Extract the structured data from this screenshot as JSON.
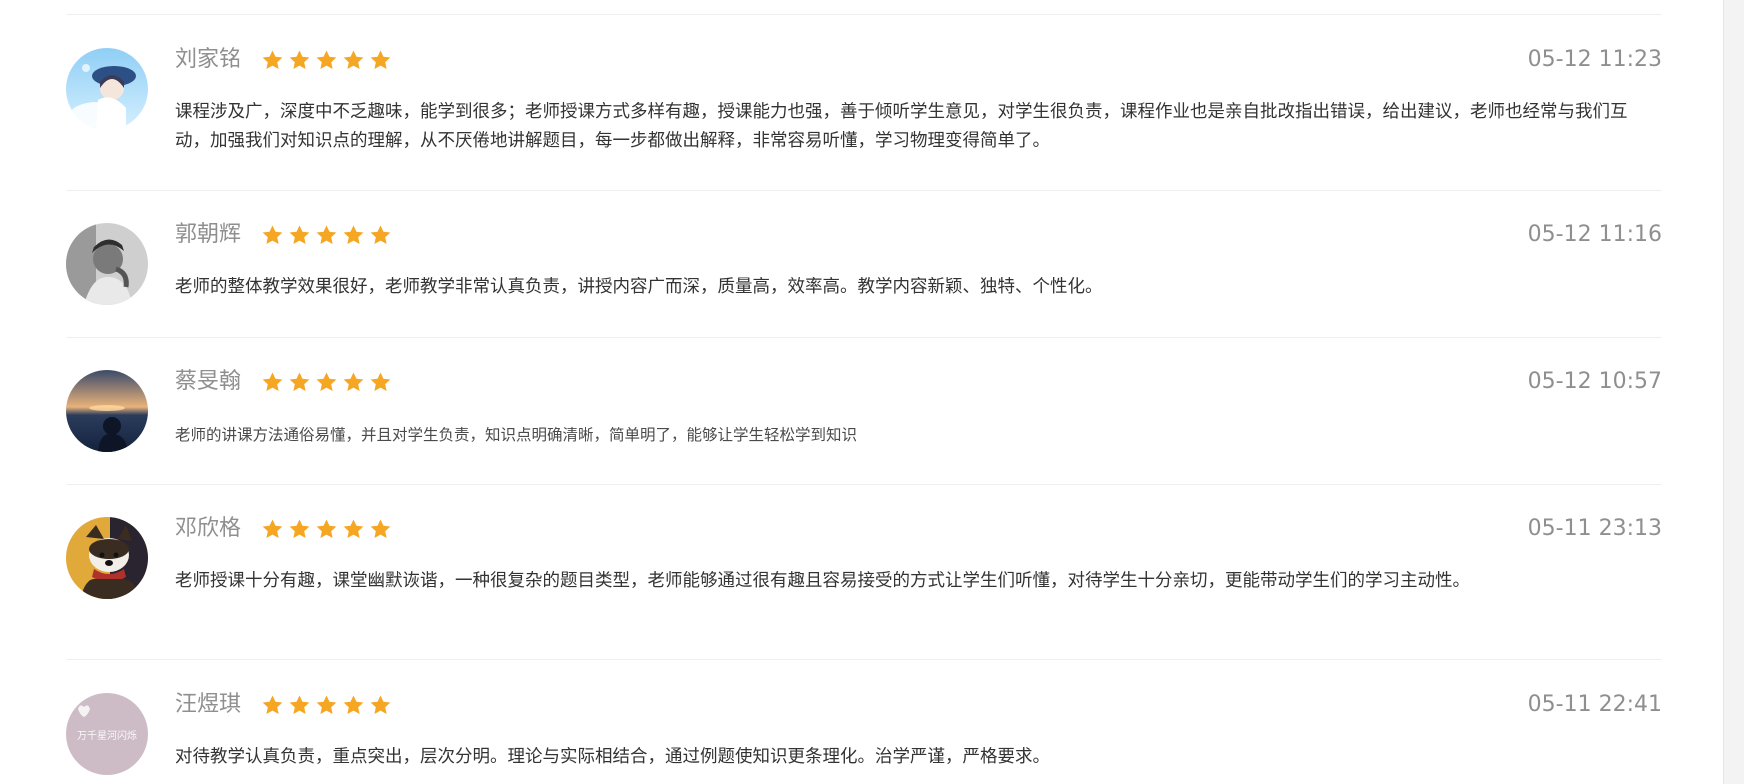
{
  "reviews": [
    {
      "name": "刘家铭",
      "rating": 5,
      "time": "05-12 11:23",
      "content": "课程涉及广，深度中不乏趣味，能学到很多；老师授课方式多样有趣，授课能力也强，善于倾听学生意见，对学生很负责，课程作业也是亲自批改指出错误，给出建议，老师也经常与我们互动，加强我们对知识点的理解，从不厌倦地讲解题目，每一步都做出解释，非常容易听懂，学习物理变得简单了。"
    },
    {
      "name": "郭朝辉",
      "rating": 5,
      "time": "05-12 11:16",
      "content": "老师的整体教学效果很好，老师教学非常认真负责，讲授内容广而深，质量高，效率高。教学内容新颖、独特、个性化。"
    },
    {
      "name": "蔡旻翰",
      "rating": 5,
      "time": "05-12 10:57",
      "content": "老师的讲课方法通俗易懂，并且对学生负责，知识点明确清晰，简单明了，能够让学生轻松学到知识"
    },
    {
      "name": "邓欣格",
      "rating": 5,
      "time": "05-11 23:13",
      "content": "老师授课十分有趣，课堂幽默诙谐，一种很复杂的题目类型，老师能够通过很有趣且容易接受的方式让学生们听懂，对待学生十分亲切，更能带动学生们的学习主动性。"
    },
    {
      "name": "汪煜琪",
      "rating": 5,
      "time": "05-11 22:41",
      "content": "对待教学认真负责，重点突出，层次分明。理论与实际相结合，通过例题使知识更条理化。治学严谨，严格要求。"
    }
  ],
  "colors": {
    "star": "#f5a623",
    "name": "#8f8f8f",
    "time": "#8f8f8f",
    "content": "#333333",
    "divider": "#efefef"
  },
  "icons": {
    "rating": "star-icon"
  },
  "avatar5_text": "万千星河闪烁"
}
